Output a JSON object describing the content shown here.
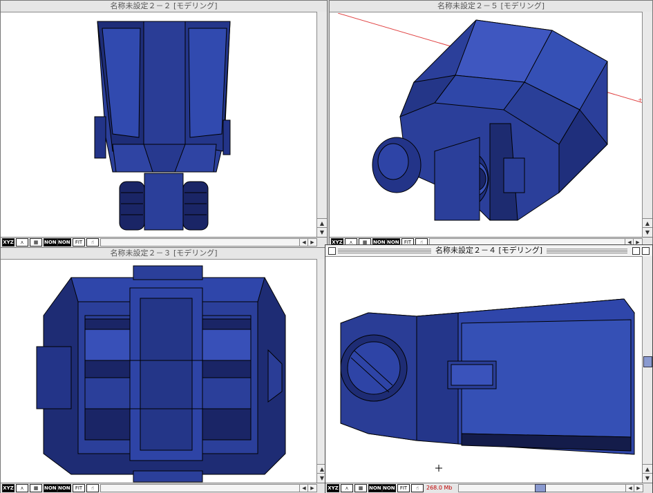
{
  "windows": {
    "tl": {
      "title": "名称未設定２－２ [モデリング]"
    },
    "tr": {
      "title": "名称未設定２－５ [モデリング]",
      "axis_label": "+X"
    },
    "bl": {
      "title": "名称未設定２－３ [モデリング]"
    },
    "br": {
      "title": "名称未設定２－４ [モデリング]",
      "memory": "268.0 Mb"
    }
  },
  "toolbar": {
    "xyz_label": "XYZ",
    "grid_label": "grid",
    "none1_label": "NONE",
    "none2_label": "NONE",
    "fit_label": "FIT",
    "arrow_up": "▲",
    "arrow_down": "▼",
    "arrow_left": "◀",
    "arrow_right": "▶"
  },
  "colors": {
    "model_fill": "#2b3f9a",
    "model_dark": "#141c4a",
    "model_light": "#4058c0",
    "axis_line": "#e04040",
    "memory_text": "#c00000"
  },
  "icons": [
    "xyz-axis-icon",
    "perspective-icon",
    "grid-icon",
    "none-toggle",
    "fit-button",
    "hand-pan-icon",
    "crosshair-cursor-icon"
  ]
}
